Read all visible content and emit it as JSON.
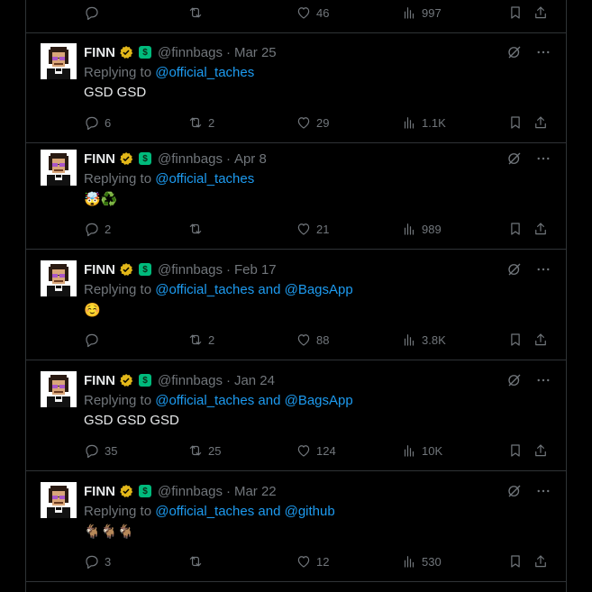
{
  "top_actions": {
    "reply": "",
    "retweet": "",
    "like": "46",
    "views": "997"
  },
  "tweets": [
    {
      "name": "FINN",
      "handle": "@finnbags",
      "dot": "·",
      "date": "Mar 25",
      "replying_prefix": "Replying to",
      "replying_to": "@official_taches",
      "text": "GSD GSD",
      "reply": "6",
      "retweet": "2",
      "like": "29",
      "views": "1.1K"
    },
    {
      "name": "FINN",
      "handle": "@finnbags",
      "dot": "·",
      "date": "Apr 8",
      "replying_prefix": "Replying to",
      "replying_to": "@official_taches",
      "text": "🤯♻️",
      "reply": "2",
      "retweet": "",
      "like": "21",
      "views": "989"
    },
    {
      "name": "FINN",
      "handle": "@finnbags",
      "dot": "·",
      "date": "Feb 17",
      "replying_prefix": "Replying to",
      "replying_to": "@official_taches and @BagsApp",
      "text": "☺️",
      "reply": "",
      "retweet": "2",
      "like": "88",
      "views": "3.8K"
    },
    {
      "name": "FINN",
      "handle": "@finnbags",
      "dot": "·",
      "date": "Jan 24",
      "replying_prefix": "Replying to",
      "replying_to": "@official_taches and @BagsApp",
      "text": "GSD GSD GSD",
      "reply": "35",
      "retweet": "25",
      "like": "124",
      "views": "10K"
    },
    {
      "name": "FINN",
      "handle": "@finnbags",
      "dot": "·",
      "date": "Mar 22",
      "replying_prefix": "Replying to",
      "replying_to": "@official_taches and @github",
      "text": "🐐🐐🐐",
      "reply": "3",
      "retweet": "",
      "like": "12",
      "views": "530"
    }
  ],
  "colors": {
    "background": "#000000",
    "link": "#1d9bf0",
    "muted": "#71767b",
    "verified": "#e2b719",
    "divider": "#2f3336"
  },
  "icons": {
    "reply": "reply-icon",
    "retweet": "retweet-icon",
    "like": "heart-icon",
    "views": "views-icon",
    "bookmark": "bookmark-icon",
    "share": "share-icon",
    "grok": "grok-icon",
    "more": "more-icon"
  }
}
